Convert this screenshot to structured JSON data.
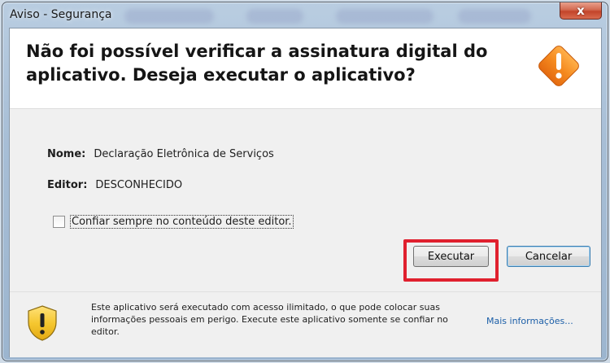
{
  "window": {
    "title": "Aviso - Segurança",
    "close_glyph": "x"
  },
  "header": {
    "headline": "Não foi possível verificar a assinatura digital do aplicativo.  Deseja executar o aplicativo?",
    "icon": "warning-diamond-icon"
  },
  "details": {
    "name_label": "Nome:",
    "name_value": "Declaração Eletrônica de Serviços",
    "publisher_label": "Editor:",
    "publisher_value": "DESCONHECIDO"
  },
  "checkbox": {
    "label": "Confiar sempre no conteúdo deste editor.",
    "checked": false
  },
  "buttons": {
    "run": "Executar",
    "cancel": "Cancelar"
  },
  "footer": {
    "icon": "shield-warning-icon",
    "text": "Este aplicativo será executado com acesso ilimitado, o que pode colocar suas informações pessoais em perigo. Execute este aplicativo somente se confiar no editor.",
    "more_info": "Mais informações..."
  },
  "colors": {
    "highlight": "#e0202e",
    "warning_orange": "#f07f1b",
    "shield_yellow": "#f3c12c",
    "link": "#1c5fa8"
  }
}
